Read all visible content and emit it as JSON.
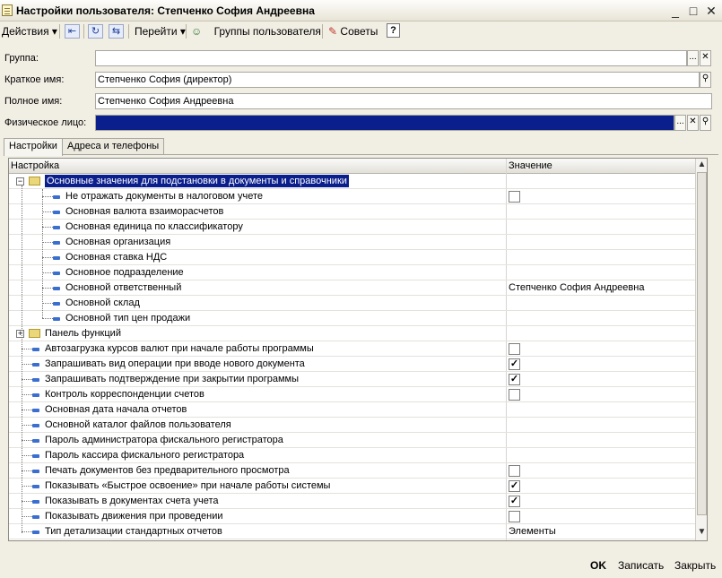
{
  "window": {
    "title": "Настройки пользователя: Степченко София Андреевна",
    "minimize_glyph": "_",
    "maximize_glyph": "□",
    "close_glyph": "✕"
  },
  "toolbar": {
    "actions_label": "Действия",
    "goto_label": "Перейти",
    "user_groups_label": "Группы пользователя",
    "tips_label": "Советы",
    "help_label": "?",
    "dropdown_glyph": "▾"
  },
  "form": {
    "group_label": "Группа:",
    "group_value": "",
    "short_name_label": "Краткое имя:",
    "short_name_value": "Степченко София (директор)",
    "full_name_label": "Полное имя:",
    "full_name_value": "Степченко София Андреевна",
    "person_label": "Физическое лицо:",
    "person_value": "",
    "select_glyph": "...",
    "clear_glyph": "✕",
    "search_glyph": "⚲"
  },
  "tabs": [
    "Настройки",
    "Адреса и телефоны"
  ],
  "table": {
    "col_setting": "Настройка",
    "col_value": "Значение",
    "rows": [
      {
        "label": "Основные значения для подстановки в документы и справочники",
        "level": 0,
        "kind": "group",
        "expanded": true,
        "selected": true,
        "value": ""
      },
      {
        "label": "Не отражать документы в налоговом учете",
        "level": 1,
        "kind": "item",
        "checkbox": true,
        "checked": false,
        "value": ""
      },
      {
        "label": "Основная валюта взаиморасчетов",
        "level": 1,
        "kind": "item",
        "value": ""
      },
      {
        "label": "Основная единица по классификатору",
        "level": 1,
        "kind": "item",
        "value": ""
      },
      {
        "label": "Основная организация",
        "level": 1,
        "kind": "item",
        "value": ""
      },
      {
        "label": "Основная ставка НДС",
        "level": 1,
        "kind": "item",
        "value": ""
      },
      {
        "label": "Основное подразделение",
        "level": 1,
        "kind": "item",
        "value": ""
      },
      {
        "label": "Основной ответственный",
        "level": 1,
        "kind": "item",
        "value": "Степченко София Андреевна"
      },
      {
        "label": "Основной склад",
        "level": 1,
        "kind": "item",
        "value": ""
      },
      {
        "label": "Основной тип цен продажи",
        "level": 1,
        "kind": "item",
        "value": ""
      },
      {
        "label": "Панель функций",
        "level": 0,
        "kind": "group",
        "expanded": false,
        "value": ""
      },
      {
        "label": "Автозагрузка курсов валют при начале работы программы",
        "level": 0,
        "kind": "item",
        "checkbox": true,
        "checked": false,
        "value": ""
      },
      {
        "label": "Запрашивать вид операции при вводе нового документа",
        "level": 0,
        "kind": "item",
        "checkbox": true,
        "checked": true,
        "value": ""
      },
      {
        "label": "Запрашивать подтверждение при закрытии программы",
        "level": 0,
        "kind": "item",
        "checkbox": true,
        "checked": true,
        "value": ""
      },
      {
        "label": "Контроль корреспонденции счетов",
        "level": 0,
        "kind": "item",
        "checkbox": true,
        "checked": false,
        "value": ""
      },
      {
        "label": "Основная дата начала отчетов",
        "level": 0,
        "kind": "item",
        "value": ""
      },
      {
        "label": "Основной каталог файлов пользователя",
        "level": 0,
        "kind": "item",
        "value": ""
      },
      {
        "label": "Пароль администратора фискального регистратора",
        "level": 0,
        "kind": "item",
        "value": ""
      },
      {
        "label": "Пароль кассира фискального регистратора",
        "level": 0,
        "kind": "item",
        "value": ""
      },
      {
        "label": "Печать документов без предварительного просмотра",
        "level": 0,
        "kind": "item",
        "checkbox": true,
        "checked": false,
        "value": ""
      },
      {
        "label": "Показывать «Быстрое освоение» при начале работы системы",
        "level": 0,
        "kind": "item",
        "checkbox": true,
        "checked": true,
        "value": ""
      },
      {
        "label": "Показывать в документах счета учета",
        "level": 0,
        "kind": "item",
        "checkbox": true,
        "checked": true,
        "value": ""
      },
      {
        "label": "Показывать движения при проведении",
        "level": 0,
        "kind": "item",
        "checkbox": true,
        "checked": false,
        "value": ""
      },
      {
        "label": "Тип детализации стандартных отчетов",
        "level": 0,
        "kind": "item",
        "value": "Элементы"
      }
    ]
  },
  "footer": {
    "ok_label": "OK",
    "save_label": "Записать",
    "close_label": "Закрыть"
  },
  "colors": {
    "selection": "#0a1e8c",
    "window_bg": "#f1eee4",
    "item_marker": "#3a6fd0"
  }
}
